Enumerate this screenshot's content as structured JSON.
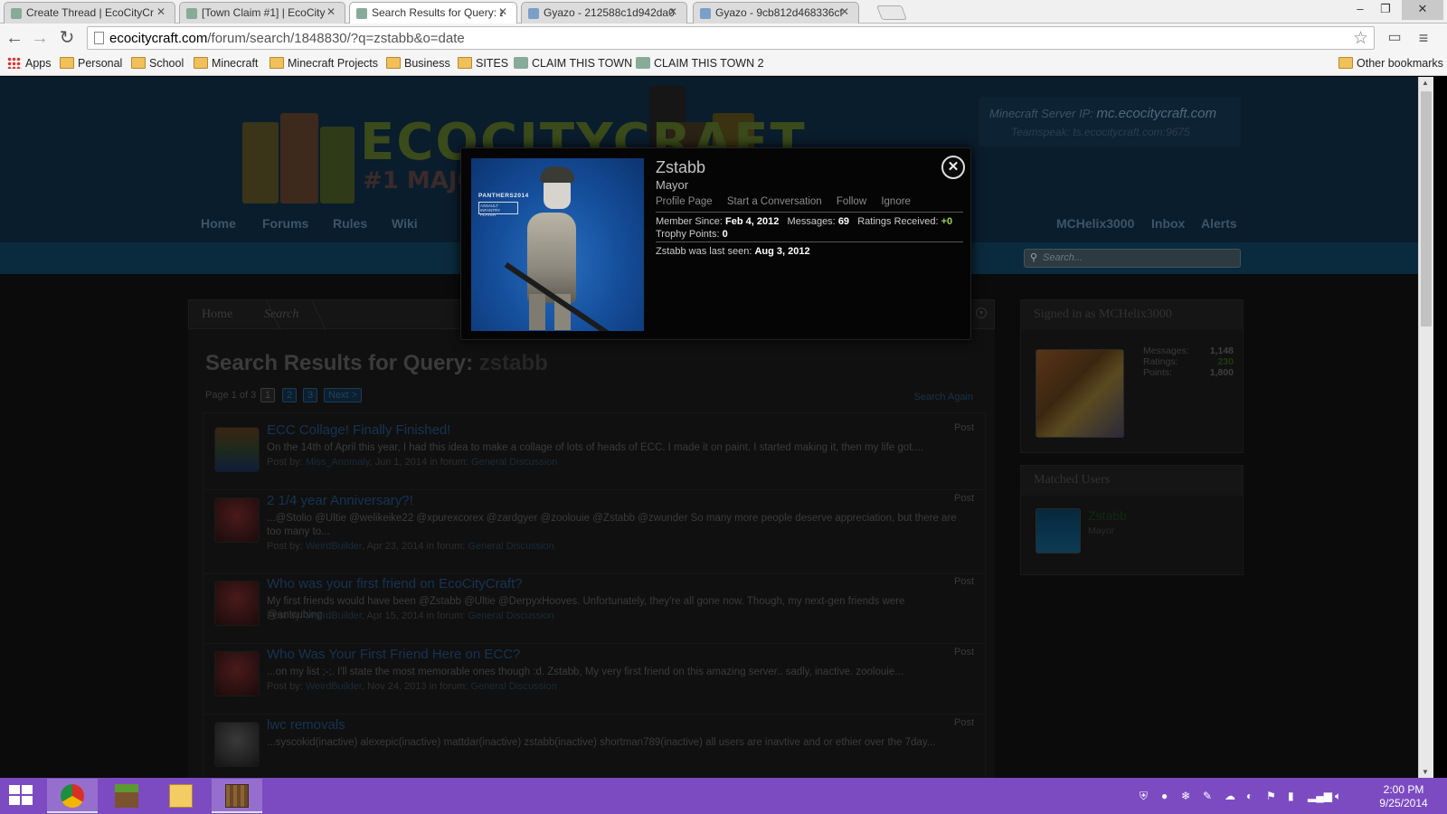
{
  "browser": {
    "tabs": [
      {
        "title": "Create Thread | EcoCityCr",
        "active": false
      },
      {
        "title": "[Town Claim #1] | EcoCity",
        "active": false
      },
      {
        "title": "Search Results for Query: z",
        "active": true
      },
      {
        "title": "Gyazo - 212588c1d942da0",
        "active": false
      },
      {
        "title": "Gyazo - 9cb812d468336cf",
        "active": false
      }
    ],
    "url_domain": "ecocitycraft.com",
    "url_path": "/forum/search/1848830/?q=zstabb&o=date",
    "bookmarks": [
      {
        "label": "Apps",
        "icon": "apps-grid-icon"
      },
      {
        "label": "Personal",
        "icon": "folder-icon"
      },
      {
        "label": "School",
        "icon": "folder-icon"
      },
      {
        "label": "Minecraft",
        "icon": "folder-icon"
      },
      {
        "label": "Minecraft Projects",
        "icon": "folder-icon"
      },
      {
        "label": "Business",
        "icon": "folder-icon"
      },
      {
        "label": "SITES",
        "icon": "folder-icon"
      },
      {
        "label": "CLAIM THIS TOWN",
        "icon": "site-favicon-icon"
      },
      {
        "label": "CLAIM THIS TOWN 2",
        "icon": "site-favicon-icon"
      }
    ],
    "other_bookmarks": "Other bookmarks"
  },
  "site": {
    "logo_text": "ECOCITYCRAFT",
    "logo_sub": "#1 MAJO",
    "server_ip_label": "Minecraft Server IP:",
    "server_ip": "mc.ecocitycraft.com",
    "teamspeak": "Teamspeak: ts.ecocitycraft.com:9675",
    "nav": [
      "Home",
      "Forums",
      "Rules",
      "Wiki"
    ],
    "user_nav": [
      "MCHelix3000",
      "Inbox",
      "Alerts"
    ],
    "search_placeholder": "Search..."
  },
  "breadcrumb": [
    "Home",
    "Search"
  ],
  "search": {
    "title_prefix": "Search Results for Query:",
    "query": "zstabb",
    "page_info": "Page 1 of 3",
    "pages": [
      "1",
      "2",
      "3",
      "Next >"
    ],
    "search_again": "Search Again"
  },
  "results": [
    {
      "title": "ECC Collage! Finally Finished!",
      "snippet": "On the 14th of April this year, I had this idea to make a collage of lots of heads of ECC. I made it on paint. I started making it, then my life got....",
      "post_by_label": "Post by:",
      "author": "Miss_Anomaly",
      "date": ", Jun 1, 2014 in forum:",
      "forum": "General Discussion",
      "kind": "Post"
    },
    {
      "title": "2 1/4 year Anniversary?!",
      "snippet": "...@Stolio @Ultie @welikeike22 @xpurexcorex @zardgyer @zoolouie @Zstabb @zwunder So many more people deserve appreciation, but there are too many to...",
      "post_by_label": "Post by:",
      "author": "WeirdBuilder",
      "date": ", Apr 23, 2014 in forum:",
      "forum": "General Discussion",
      "kind": "Post"
    },
    {
      "title": "Who was your first friend on EcoCityCraft?",
      "snippet": "My first friends would have been @Zstabb @Ultie @DerpyxHooves. Unfortunately, they're all gone now. Though, my next-gen friends were @antcubing....",
      "post_by_label": "Post by:",
      "author": "WeirdBuilder",
      "date": ", Apr 15, 2014 in forum:",
      "forum": "General Discussion",
      "kind": "Post"
    },
    {
      "title": "Who Was Your First Friend Here on ECC?",
      "snippet": "...on my list ;-;. I'll state the most memorable ones though :d. Zstabb, My very first friend on this amazing server.. sadly, inactive. zoolouie...",
      "post_by_label": "Post by:",
      "author": "WeirdBuilder",
      "date": ", Nov 24, 2013 in forum:",
      "forum": "General Discussion",
      "kind": "Post"
    },
    {
      "title": "lwc removals",
      "snippet": "...syscokid(inactive) alexepic(inactive) mattdar(inactive) zstabb(inactive) shortman789(inactive) all users are inavtive and or ethier over the 7day...",
      "post_by_label": "Post by:",
      "author": "",
      "date": "",
      "forum": "",
      "kind": "Post"
    }
  ],
  "sidebar": {
    "signed_in": "Signed in as MCHelix3000",
    "stats": [
      {
        "label": "Messages:",
        "value": "1,148"
      },
      {
        "label": "Ratings:",
        "value": "230"
      },
      {
        "label": "Points:",
        "value": "1,800"
      }
    ],
    "matched_users_title": "Matched Users",
    "matched_user": {
      "name": "Zstabb",
      "role": "Mayor"
    }
  },
  "popup": {
    "photo_tag": "PANTHERS2014",
    "photo_tag2": "ASSAULT · INFANTRY PLAYER",
    "username": "Zstabb",
    "role": "Mayor",
    "links": [
      "Profile Page",
      "Start a Conversation",
      "Follow",
      "Ignore"
    ],
    "member_since_label": "Member Since:",
    "member_since": "Feb 4, 2012",
    "messages_label": "Messages:",
    "messages": "69",
    "ratings_label": "Ratings Received:",
    "ratings": "+0",
    "trophy_label": "Trophy Points:",
    "trophy": "0",
    "last_seen_label": "Zstabb was last seen:",
    "last_seen": "Aug 3, 2012"
  },
  "taskbar": {
    "time": "2:00 PM",
    "date": "9/25/2014"
  },
  "colors": {
    "taskbar": "#7c4bc2",
    "popup_bg": "#050505",
    "positive": "#9bd34a"
  }
}
